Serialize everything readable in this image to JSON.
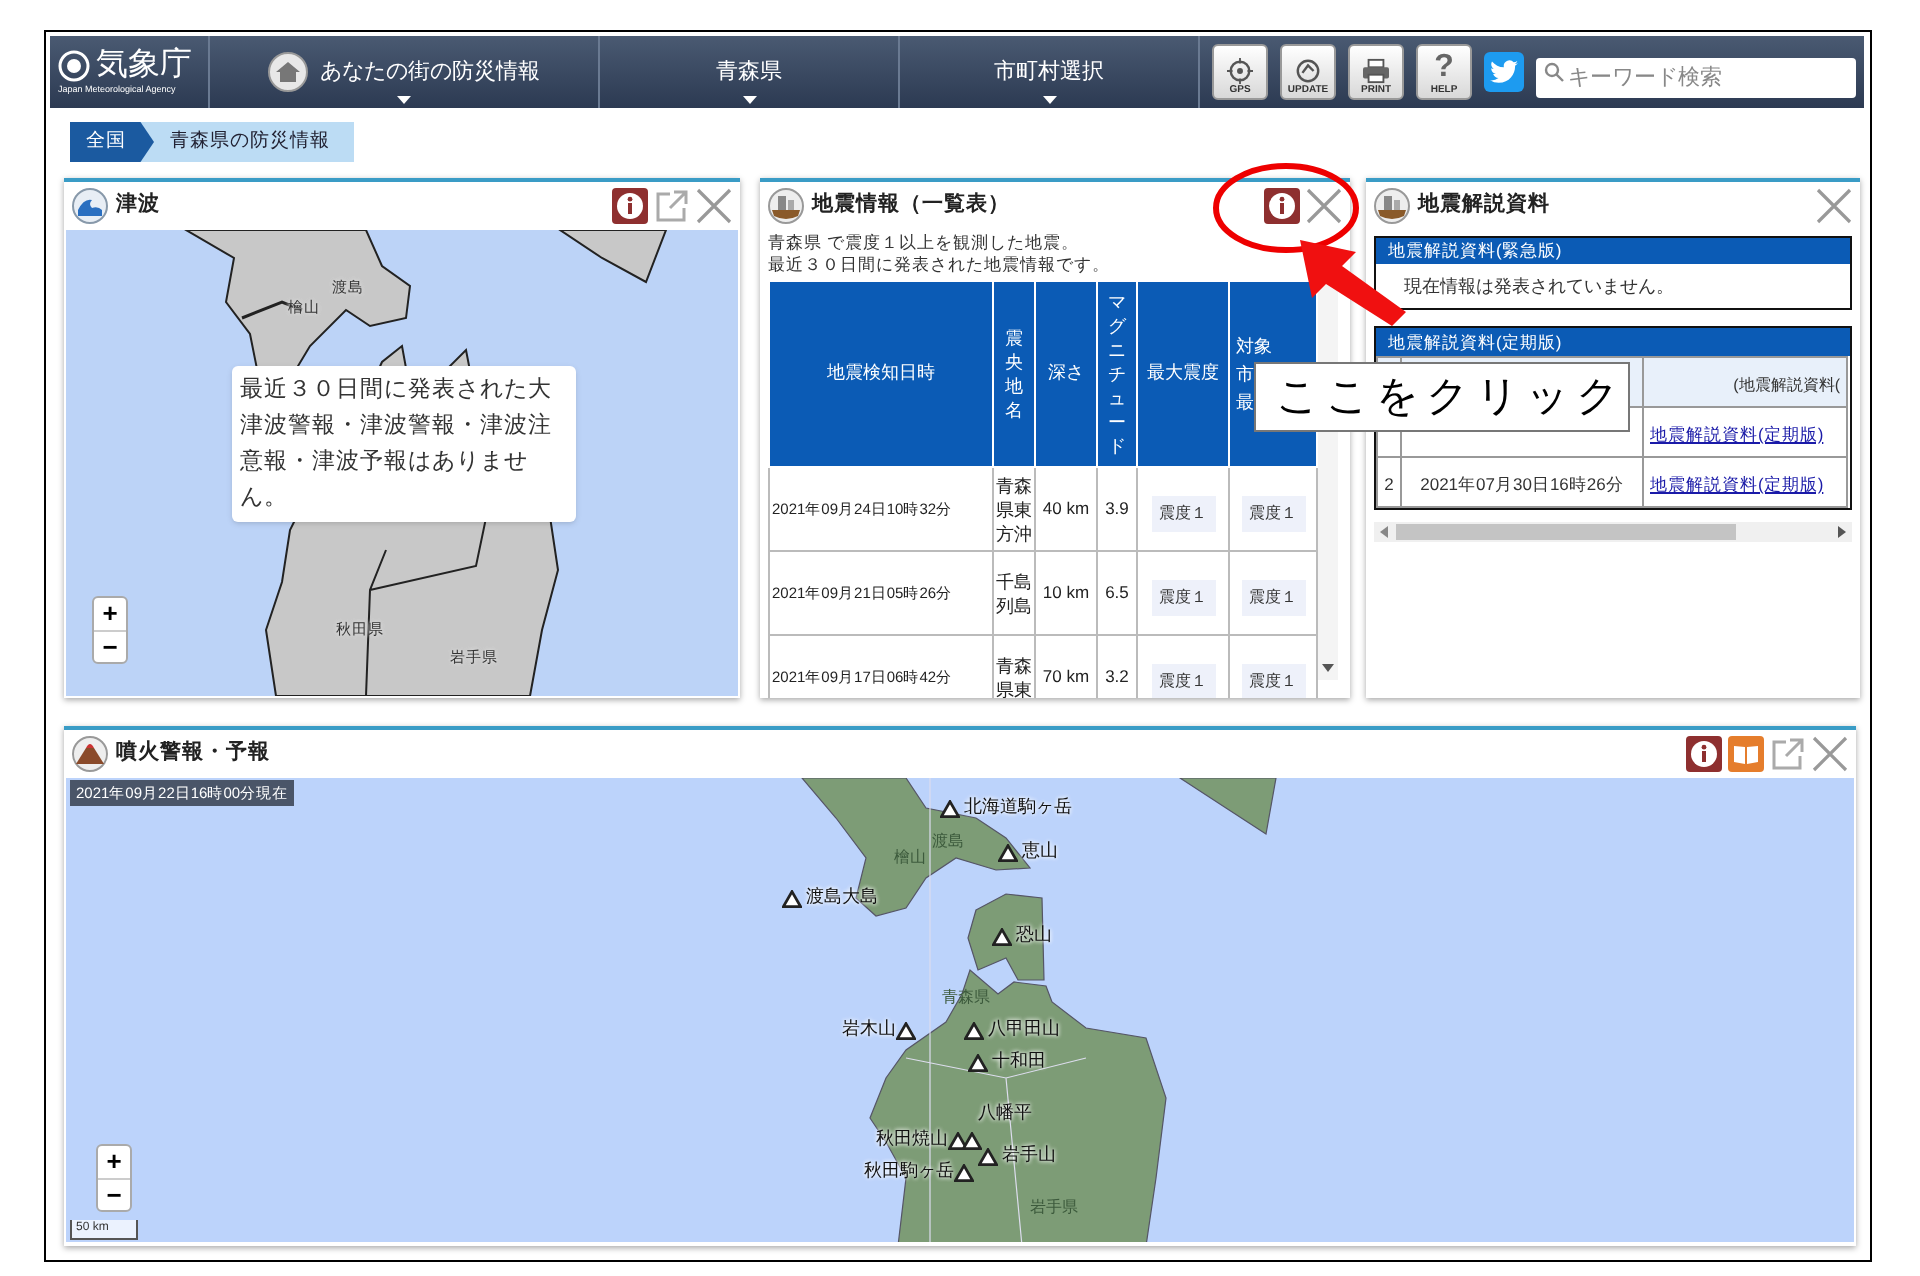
{
  "header": {
    "logo": "気象庁",
    "logo_subtitle": "Japan Meteorological Agency",
    "nav": [
      {
        "kind": "home",
        "label": "あなたの街の防災情報"
      },
      {
        "kind": "dropdown",
        "label": "青森県"
      },
      {
        "kind": "dropdown",
        "label": "市町村選択"
      }
    ],
    "tools": [
      {
        "kind": "gps",
        "label": "GPS"
      },
      {
        "kind": "update",
        "label": "UPDATE"
      },
      {
        "kind": "print",
        "label": "PRINT"
      },
      {
        "kind": "help",
        "label": "HELP",
        "glyph": "?"
      },
      {
        "kind": "bird"
      }
    ],
    "search": {
      "placeholder": "キーワード検索"
    }
  },
  "breadcrumb": [
    {
      "label": "全国",
      "current": false
    },
    {
      "label": "青森県の防災情報",
      "current": true
    }
  ],
  "tsunami": {
    "title": "津波",
    "map_labels": [
      "渡島",
      "檜山",
      "秋田県",
      "岩手県"
    ],
    "zoom": [
      "+",
      "−"
    ],
    "message": "最近３０日間に発表された大津波警報・津波警報・津波注意報・津波予報はありません。"
  },
  "earthquakes": {
    "title": "地震情報（一覧表）",
    "intro": [
      "青森県 で震度１以上を観測した地震。",
      "最近３０日間に発表された地震情報です。"
    ],
    "columns": [
      {
        "label": "地震検知日時",
        "vertical": false
      },
      {
        "label": "震央地名",
        "vertical": true
      },
      {
        "label": "深さ",
        "vertical": false
      },
      {
        "label": "マグニチュード",
        "vertical": true
      },
      {
        "label": "最大震度",
        "vertical": false
      },
      {
        "lines": [
          "対象",
          "市",
          "最"
        ]
      }
    ],
    "rows": [
      {
        "time": "2021年09月24日10時32分",
        "place": "青森県東方沖",
        "depth": "40 km",
        "magnitude": "3.9",
        "max": "震度１",
        "target": "震度１"
      },
      {
        "time": "2021年09月21日05時26分",
        "place": "千島列島",
        "depth": "10 km",
        "magnitude": "6.5",
        "max": "震度１",
        "target": "震度１"
      },
      {
        "time": "2021年09月17日06時42分",
        "place": "青森県東",
        "depth": "70 km",
        "magnitude": "3.2",
        "max": "震度１",
        "target": "震度１"
      }
    ]
  },
  "commentary": {
    "title": "地震解説資料",
    "urgent": {
      "heading": "地震解説資料(緊急版)",
      "body": "現在情報は発表されていません。"
    },
    "periodic": {
      "heading": "地震解説資料(定期版)",
      "column_3": "(地震解説資料(",
      "rows": [
        {
          "link": "地震解説資料(定期版)"
        },
        {
          "number": "2",
          "date": "2021年07月30日16時26分",
          "link": "地震解説資料(定期版)"
        }
      ]
    }
  },
  "volcano": {
    "title": "噴火警報・予報",
    "timestamp": "2021年09月22日16時00分現在",
    "volcanoes": [
      "北海道駒ヶ岳",
      "恵山",
      "渡島大島",
      "恐山",
      "岩木山",
      "八甲田山",
      "十和田",
      "秋田焼山",
      "八幡平",
      "岩手山",
      "秋田駒ヶ岳"
    ],
    "map_labels": [
      "渡島",
      "檜山",
      "青森県",
      "岩手県"
    ],
    "zoom": [
      "+",
      "−"
    ],
    "scale": "50 km"
  },
  "annotation": {
    "callout": "ここをクリック"
  }
}
